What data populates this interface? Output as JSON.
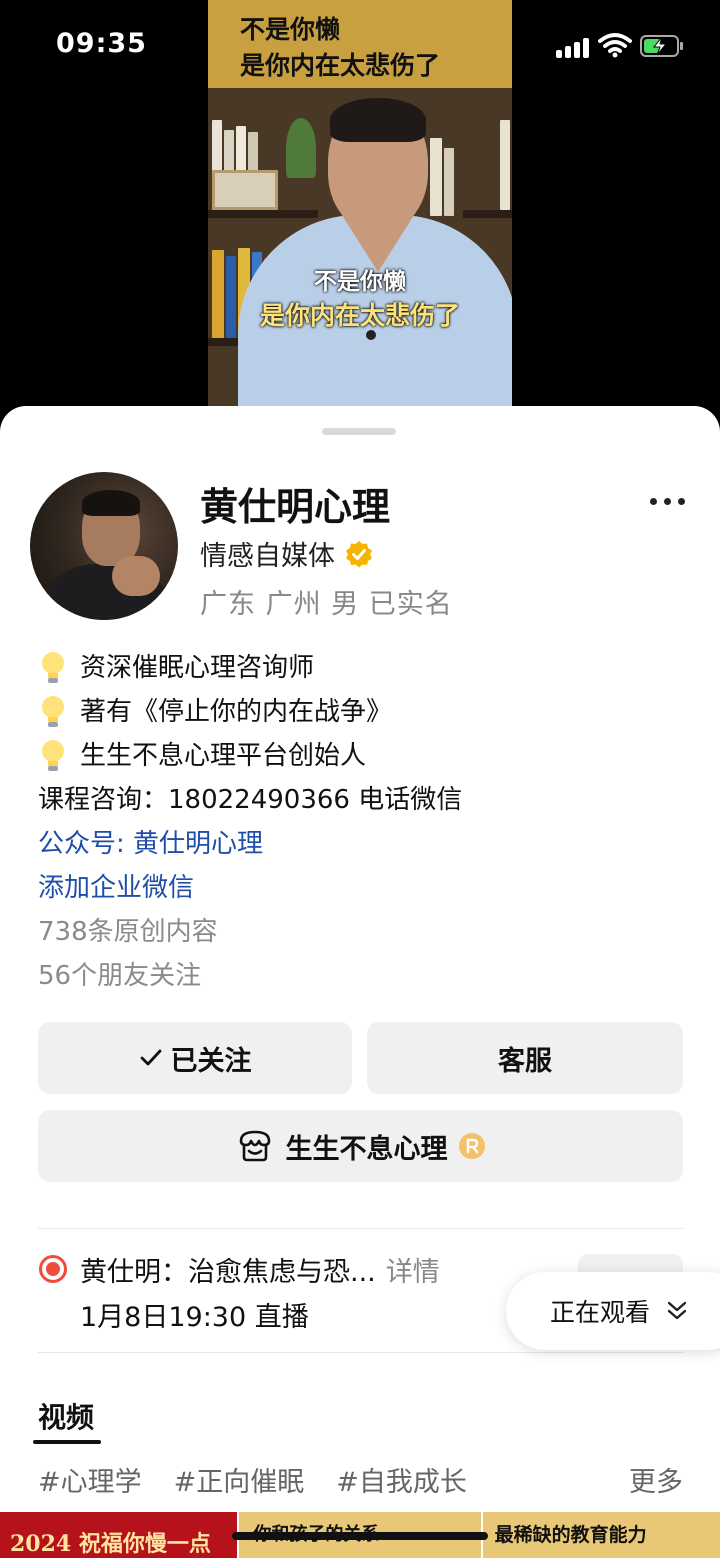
{
  "status_bar": {
    "time": "09:35"
  },
  "video": {
    "banner_line1": "不是你懒",
    "banner_line2": "是你内在太悲伤了",
    "subtitle_line1": "不是你懒",
    "subtitle_line2": "是你内在太悲伤了"
  },
  "profile": {
    "name": "黄仕明心理",
    "category": "情感自媒体",
    "location": "广东 广州 男 已实名",
    "bio": [
      "资深催眠心理咨询师",
      "著有《停止你的内在战争》",
      "生生不息心理平台创始人"
    ],
    "consult": "课程咨询：18022490366 电话微信",
    "official_account": "公众号: 黄仕明心理",
    "add_wecom": "添加企业微信",
    "original_count": "738条原创内容",
    "friends_follow": "56个朋友关注"
  },
  "actions": {
    "follow_label": "已关注",
    "service_label": "客服",
    "shop_label": "生生不息心理"
  },
  "live": {
    "title": "黄仕明：治愈焦虑与恐...",
    "detail": "详情",
    "time": "1月8日19:30 直播"
  },
  "watching": {
    "label": "正在观看"
  },
  "content": {
    "tab_label": "视频",
    "tags": [
      "#心理学",
      "#正向催眠",
      "#自我成长"
    ],
    "more_label": "更多"
  },
  "thumbnails": [
    {
      "text": "2024 祝福你慢一点"
    },
    {
      "text": "你和孩子的关系"
    },
    {
      "text": "最稀缺的教育能力"
    }
  ],
  "colors": {
    "link_blue": "#1f4ea8",
    "verified_gold": "#f5b400",
    "live_red": "#f04c3e",
    "banner_gold": "#c9a03f"
  }
}
